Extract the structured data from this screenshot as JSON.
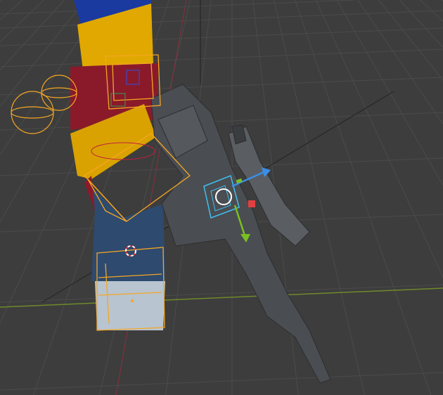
{
  "viewport": {
    "mode": "3d-viewport",
    "colors": {
      "background": "#3d3d3d",
      "grid": "#4a4a4a",
      "x_axis": "#9b3b4a",
      "y_axis": "#7a9a2a",
      "selection": "#f5a623",
      "active_outline": "#e8b020",
      "gizmo_x": "#e04040",
      "gizmo_y": "#7ac020",
      "gizmo_z": "#3a8ee6",
      "gizmo_box": "#40c0f0",
      "rig_blue": "#1a3aa0",
      "rig_yellow": "#e0a800",
      "rig_red": "#8a1a2a",
      "rig_lightblue": "#2e4a6e",
      "weapon": "#4a4d52"
    },
    "icons": [
      "move-gizmo-icon",
      "3d-cursor-icon",
      "empty-sphere-icon"
    ]
  }
}
